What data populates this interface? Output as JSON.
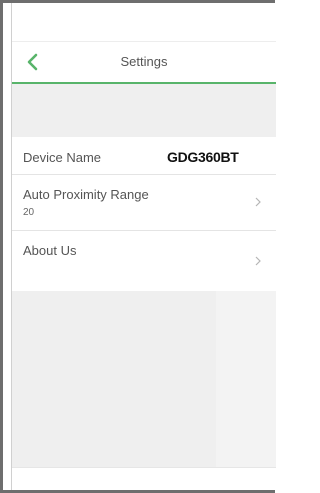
{
  "header": {
    "title": "Settings"
  },
  "rows": {
    "device_name": {
      "label": "Device Name",
      "value": "GDG360BT"
    },
    "auto_proximity": {
      "label": "Auto Proximity Range",
      "value": "20"
    },
    "about": {
      "label": "About Us"
    }
  },
  "colors": {
    "accent": "#58b46a",
    "section_background": "#efefef",
    "label_text": "#555555"
  },
  "icons": {
    "back": "chevron-left-icon",
    "row_chevron": "chevron-right-icon"
  }
}
